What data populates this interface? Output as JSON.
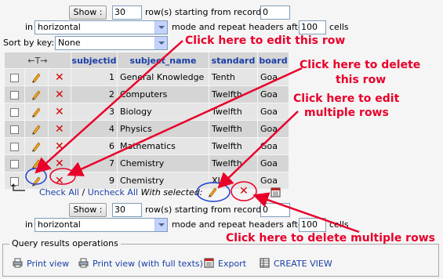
{
  "nav_top": {
    "show_label": "Show :",
    "rows_value": "30",
    "rows_text": "row(s) starting from record #",
    "start_value": "0",
    "in_label": "in",
    "mode_value": "horizontal",
    "mode_text": "mode and repeat headers after",
    "headers_value": "100",
    "cells_label": "cells"
  },
  "sort": {
    "label": "Sort by key:",
    "value": "None"
  },
  "table": {
    "arrows": "←T→",
    "columns": [
      "subjectid",
      "subject_name",
      "standard",
      "board"
    ],
    "rows": [
      {
        "subjectid": "1",
        "subject_name": "General Knowledge",
        "standard": "Tenth",
        "board": "Goa"
      },
      {
        "subjectid": "2",
        "subject_name": "Computers",
        "standard": "Twelfth",
        "board": "Goa"
      },
      {
        "subjectid": "3",
        "subject_name": "Biology",
        "standard": "Twelfth",
        "board": "Goa"
      },
      {
        "subjectid": "4",
        "subject_name": "Physics",
        "standard": "Twelfth",
        "board": "Goa"
      },
      {
        "subjectid": "6",
        "subject_name": "Mathematics",
        "standard": "Twelfth",
        "board": "Goa"
      },
      {
        "subjectid": "7",
        "subject_name": "Chemistry",
        "standard": "Twelfth",
        "board": "Goa"
      },
      {
        "subjectid": "9",
        "subject_name": "Chemistry",
        "standard": "XI",
        "board": "Goa"
      }
    ]
  },
  "selection": {
    "check_all": "Check All",
    "separator": "/",
    "uncheck_all": "Uncheck All",
    "with_selected": "With selected:"
  },
  "nav_bottom": {
    "show_label": "Show :",
    "rows_value": "30",
    "rows_text": "row(s) starting from record #",
    "start_value": "0",
    "in_label": "in",
    "mode_value": "horizontal",
    "mode_text": "mode and repeat headers after",
    "headers_value": "100",
    "cells_label": "cells"
  },
  "ops": {
    "legend": "Query results operations",
    "print_view": "Print view",
    "print_full": "Print view (with full texts)",
    "export": "Export",
    "create_view": "CREATE VIEW"
  },
  "annotations": {
    "edit_row": "Click here to edit  this row",
    "delete_row_1": "Click here to delete",
    "delete_row_2": "this row",
    "edit_multi_1": "Click here to edit",
    "edit_multi_2": "multiple rows",
    "delete_multi": "Click here to delete multiple rows"
  },
  "colors": {
    "header_text": "#1a3fa6",
    "annotation": "#e8002a",
    "delete_icon": "#d40000",
    "circle_edit": "#1f3fd0",
    "circle_delete": "#e8002a"
  }
}
